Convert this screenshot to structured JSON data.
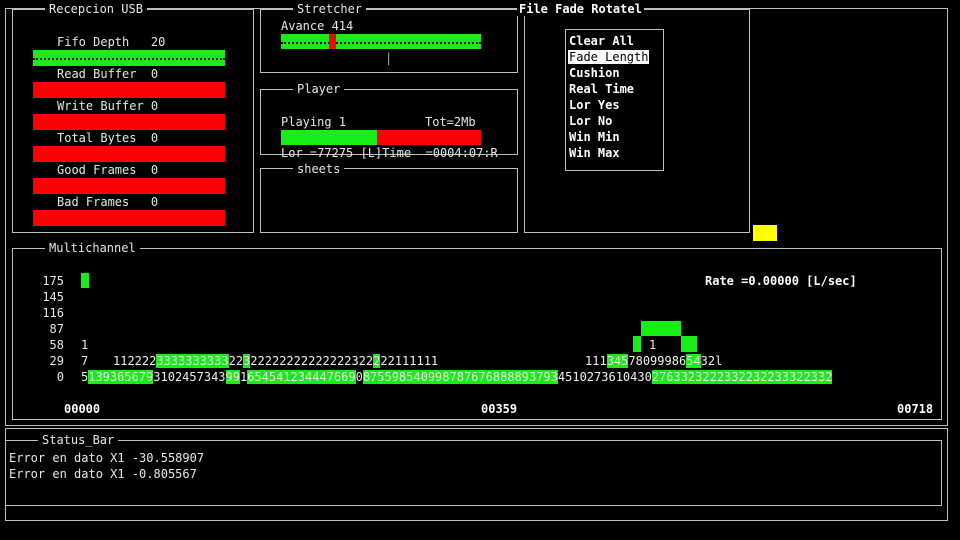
{
  "usb": {
    "title": "Recepcion USB",
    "rows": [
      {
        "label": "Fifo Depth   20",
        "color": "#14ef14"
      },
      {
        "label": "Read Buffer  0",
        "color": "#ff0000"
      },
      {
        "label": "Write Buffer 0",
        "color": "#ff0000"
      },
      {
        "label": "Total Bytes  0",
        "color": "#ff0000"
      },
      {
        "label": "Good Frames  0",
        "color": "#ff0000"
      },
      {
        "label": "Bad Frames   0",
        "color": "#ff0000"
      }
    ]
  },
  "stretcher": {
    "title": "Stretcher",
    "avance": "Avance 414",
    "tick": "|"
  },
  "player": {
    "title": "Player",
    "playing": "Playing 1",
    "total": "Tot=2Mb",
    "progress": 0.48,
    "status": "Lor =77275 [L]Time  =0004:07:R"
  },
  "sheets": {
    "title": "sheets"
  },
  "file_panel": {
    "title": "File Fade Rotatel",
    "menu": [
      "Clear All",
      "Fade Length",
      "Cushion",
      "Real Time",
      "Lor Yes",
      "Lor No",
      "Win Min",
      "Win Max"
    ],
    "selected": "Fade Length"
  },
  "multichannel": {
    "title": "Multichannel",
    "rate": "Rate =0.00000 [L/sec]",
    "y_labels": [
      "175",
      "145",
      "116",
      "87",
      "58",
      "29",
      "0"
    ],
    "row58": "1",
    "row29_left": "7",
    "row29_seq": "112222333333333322322222222222222322222111111",
    "row29_right": "111345780999865432l",
    "row0_seq": "51393656793102457343991654541234447669087559854099878767688889379345102736104302763323222332232233322332",
    "marker_58": "1",
    "x_labels": [
      "00000",
      "00359",
      "00718"
    ]
  },
  "status_bar": {
    "title": "Status_Bar",
    "lines": [
      "Error en dato X1 -30.558907",
      "Error en dato X1 -0.805567"
    ]
  },
  "colors": {
    "green": "#14ef14",
    "red": "#ff0000",
    "yellow": "#ffff00",
    "frame": "#bdbdbd"
  }
}
